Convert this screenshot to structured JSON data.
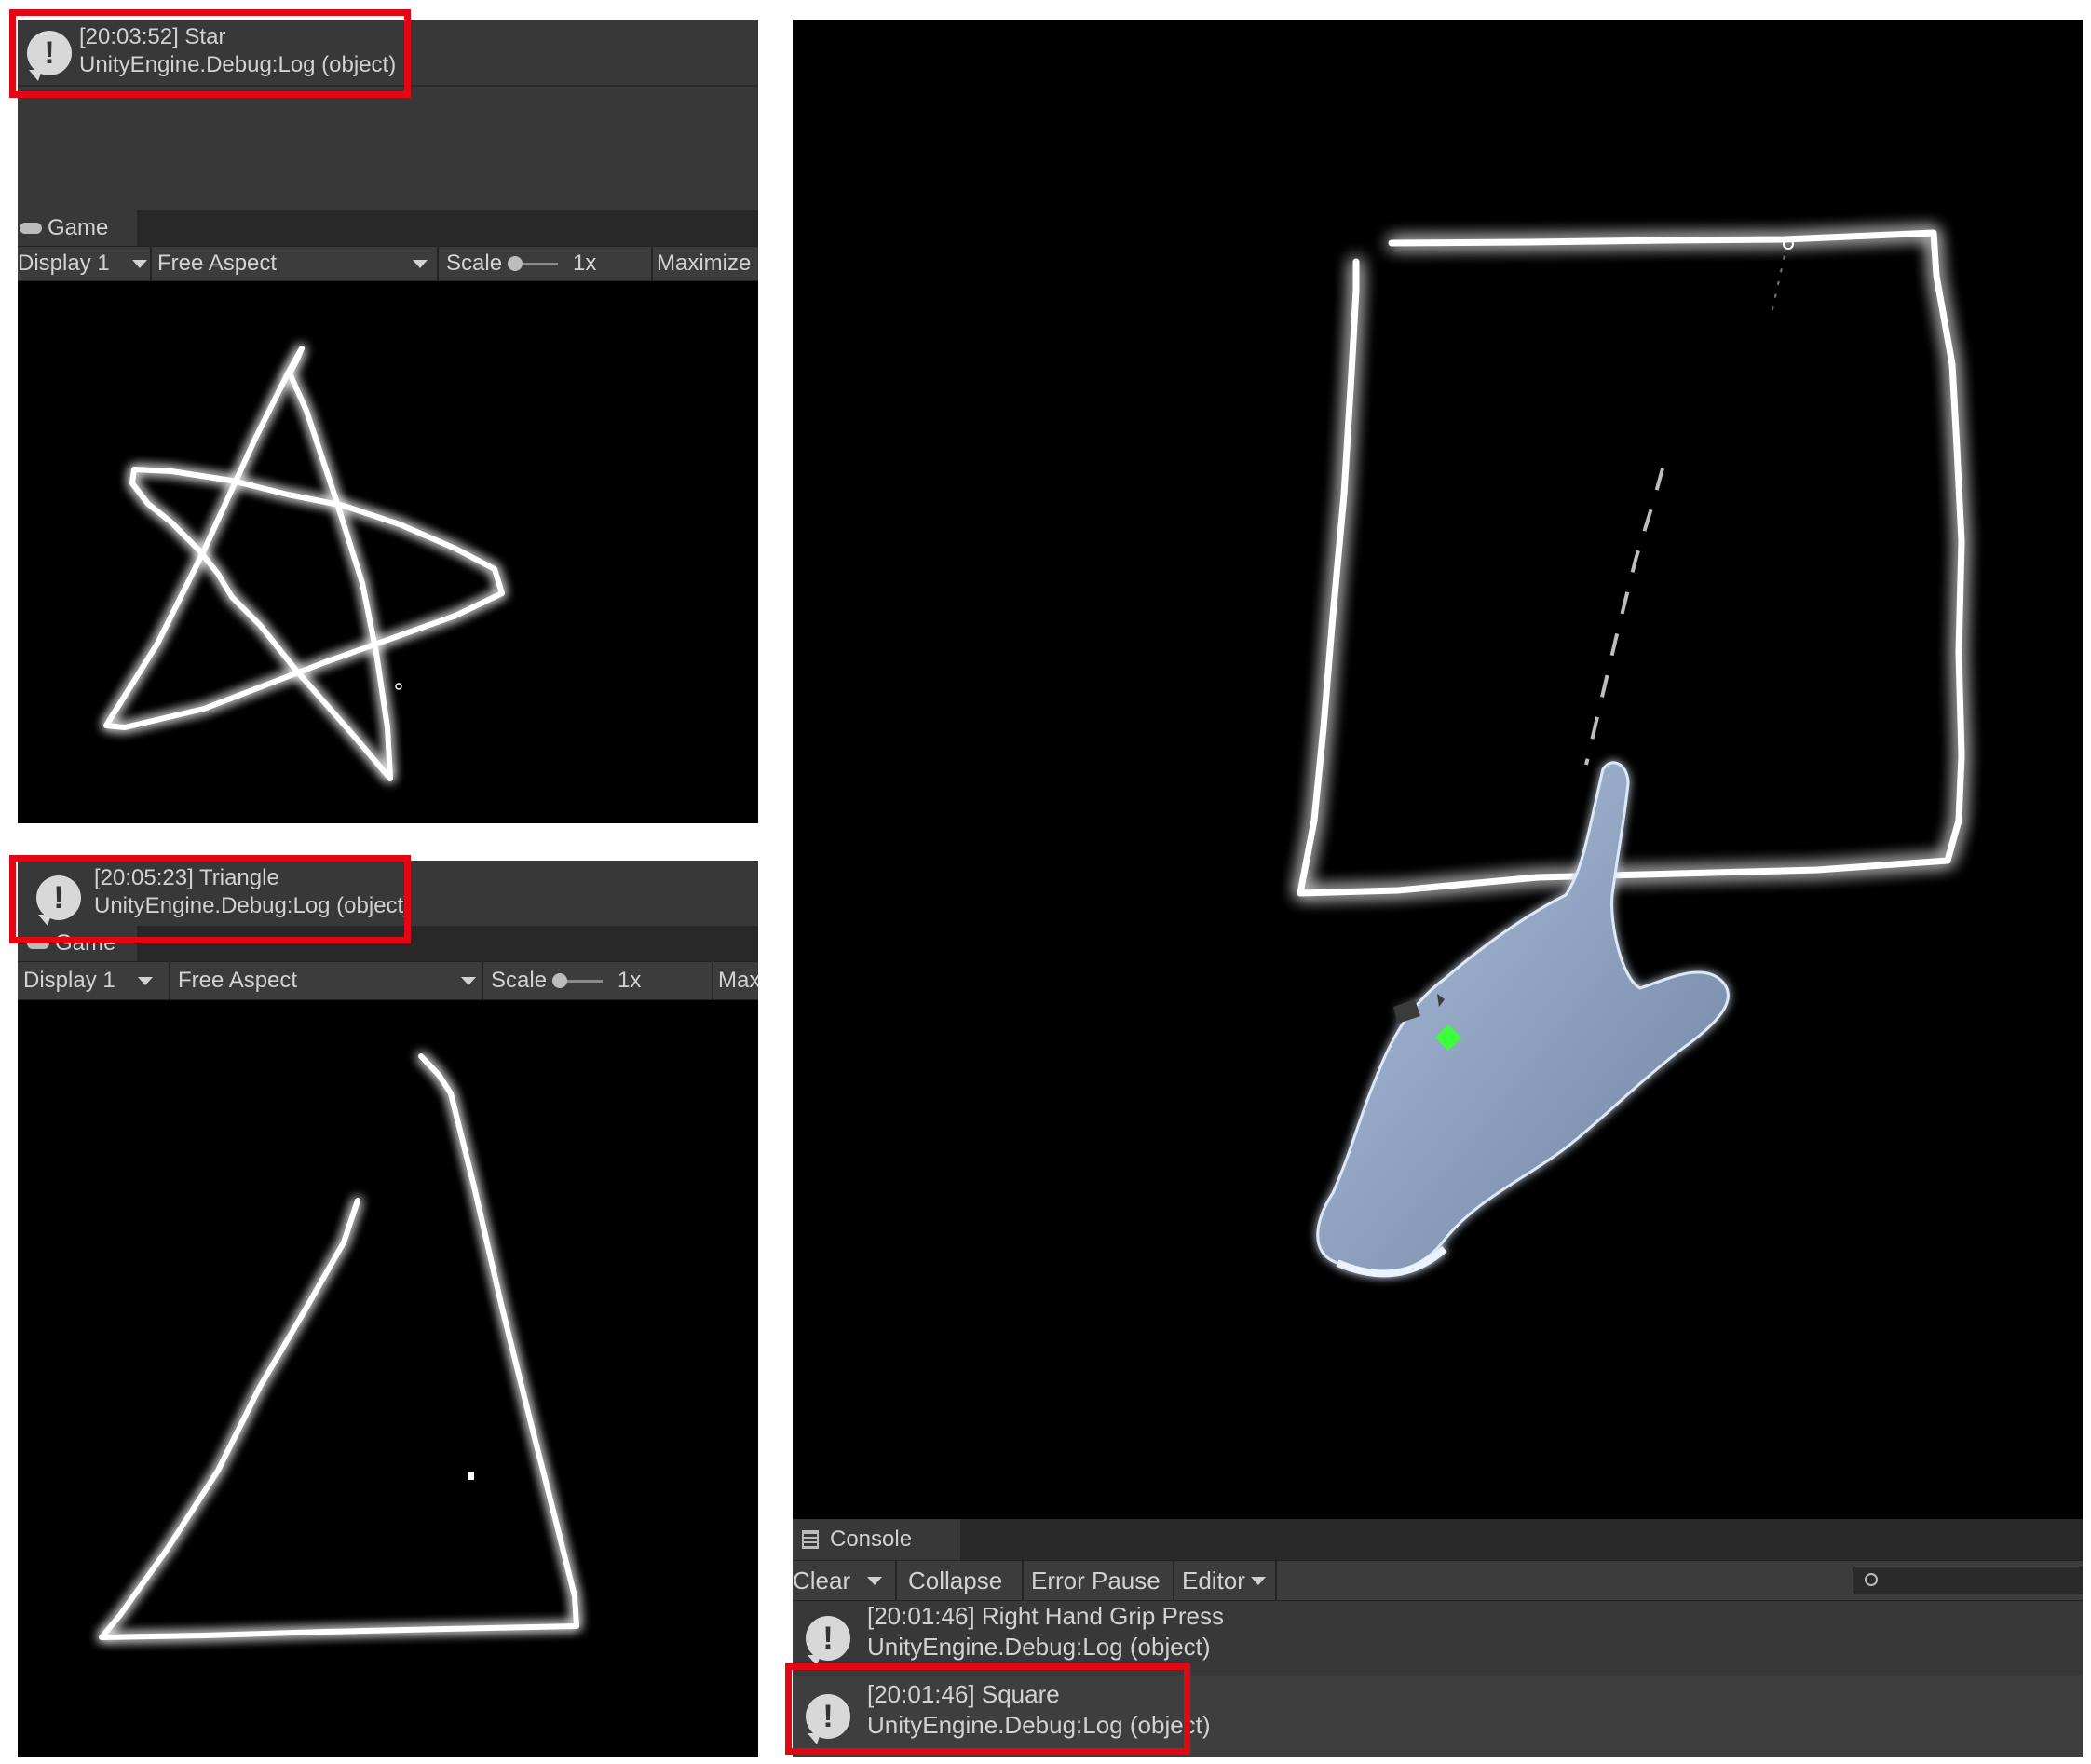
{
  "star_panel": {
    "log": {
      "time_title": "[20:03:52] Star",
      "source": "UnityEngine.Debug:Log (object)"
    },
    "game_tab": "Game",
    "toolbar": {
      "display": "Display 1",
      "aspect": "Free Aspect",
      "scale_label": "Scale",
      "scale_value": "1x",
      "maximize": "Maximize"
    }
  },
  "triangle_panel": {
    "log": {
      "time_title": "[20:05:23] Triangle",
      "source": "UnityEngine.Debug:Log (object)"
    },
    "game_tab": "Game",
    "toolbar": {
      "display": "Display 1",
      "aspect": "Free Aspect",
      "scale_label": "Scale",
      "scale_value": "1x",
      "maximize": "Max"
    }
  },
  "square_panel": {
    "console_tab": "Console",
    "toolbar": {
      "clear": "Clear",
      "collapse": "Collapse",
      "error_pause": "Error Pause",
      "editor": "Editor"
    },
    "logs": [
      {
        "time_title": "[20:01:46] Right Hand Grip Press",
        "source": "UnityEngine.Debug:Log (object)"
      },
      {
        "time_title": "[20:01:46] Square",
        "source": "UnityEngine.Debug:Log (object)"
      }
    ]
  },
  "colors": {
    "highlight": "#e30613",
    "editor_bg": "#383838",
    "stroke": "#ffffff",
    "marker": "#3dff3d"
  },
  "icons": [
    "warning-icon",
    "gamepad-icon",
    "dropdown-caret-icon",
    "console-icon",
    "search-icon",
    "hand-model"
  ]
}
